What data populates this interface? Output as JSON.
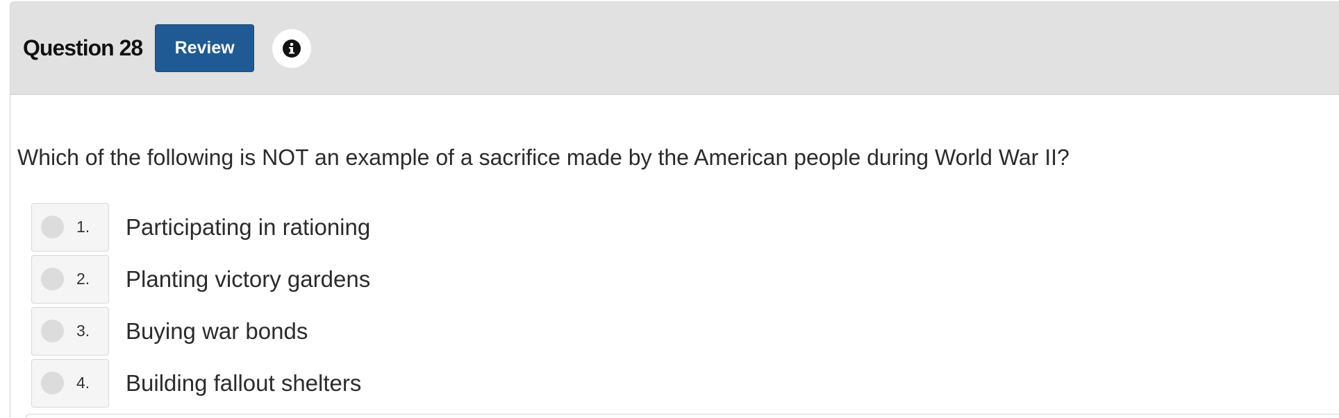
{
  "header": {
    "title": "Question 28",
    "review_label": "Review",
    "info_icon": "info-circle-icon"
  },
  "question": {
    "text": "Which of the following is NOT an example of a sacrifice made by the American people during World War II?"
  },
  "options": [
    {
      "number": "1.",
      "label": "Participating in rationing"
    },
    {
      "number": "2.",
      "label": "Planting victory gardens"
    },
    {
      "number": "3.",
      "label": "Buying war bonds"
    },
    {
      "number": "4.",
      "label": "Building fallout shelters"
    }
  ],
  "colors": {
    "header_bg": "#e1e1e1",
    "review_button": "#1f5a94",
    "radio_circle": "#dcdcdc"
  }
}
